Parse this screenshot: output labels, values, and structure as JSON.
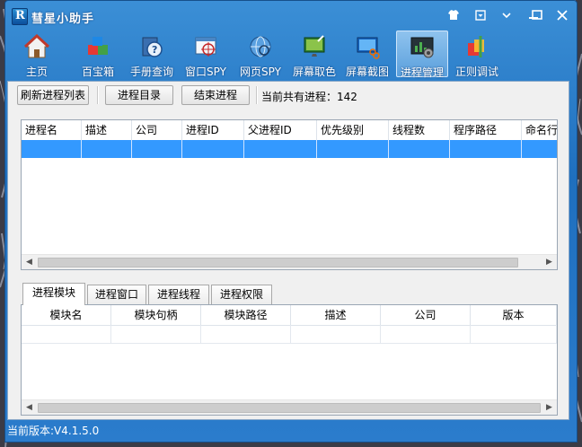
{
  "window": {
    "title": "彗星小助手"
  },
  "toolbar": {
    "items": [
      {
        "label": "主页",
        "icon": "home-icon"
      },
      {
        "label": "百宝箱",
        "icon": "toolbox-cubes-icon"
      },
      {
        "label": "手册查询",
        "icon": "manual-help-icon"
      },
      {
        "label": "窗口SPY",
        "icon": "window-spy-icon"
      },
      {
        "label": "网页SPY",
        "icon": "web-spy-icon"
      },
      {
        "label": "屏幕取色",
        "icon": "color-picker-icon"
      },
      {
        "label": "屏幕截图",
        "icon": "screenshot-icon"
      },
      {
        "label": "进程管理",
        "icon": "process-manager-icon",
        "active": true
      },
      {
        "label": "正则调试",
        "icon": "regex-debug-icon"
      }
    ]
  },
  "actions": {
    "refresh_label": "刷新进程列表",
    "open_dir_label": "进程目录",
    "end_process_label": "结束进程",
    "count_label": "当前共有进程：142"
  },
  "process_table": {
    "columns": [
      "进程名",
      "描述",
      "公司",
      "进程ID",
      "父进程ID",
      "优先级别",
      "线程数",
      "程序路径",
      "命名行"
    ]
  },
  "detail_tabs": [
    "进程模块",
    "进程窗口",
    "进程线程",
    "进程权限"
  ],
  "module_table": {
    "columns": [
      "模块名",
      "模块句柄",
      "模块路径",
      "描述",
      "公司",
      "版本"
    ]
  },
  "statusbar": {
    "version_text": "当前版本:V4.1.5.0"
  },
  "colors": {
    "titlebar": "#2b7ccc",
    "selection": "#3399ff",
    "panel": "#f0f0f0"
  }
}
